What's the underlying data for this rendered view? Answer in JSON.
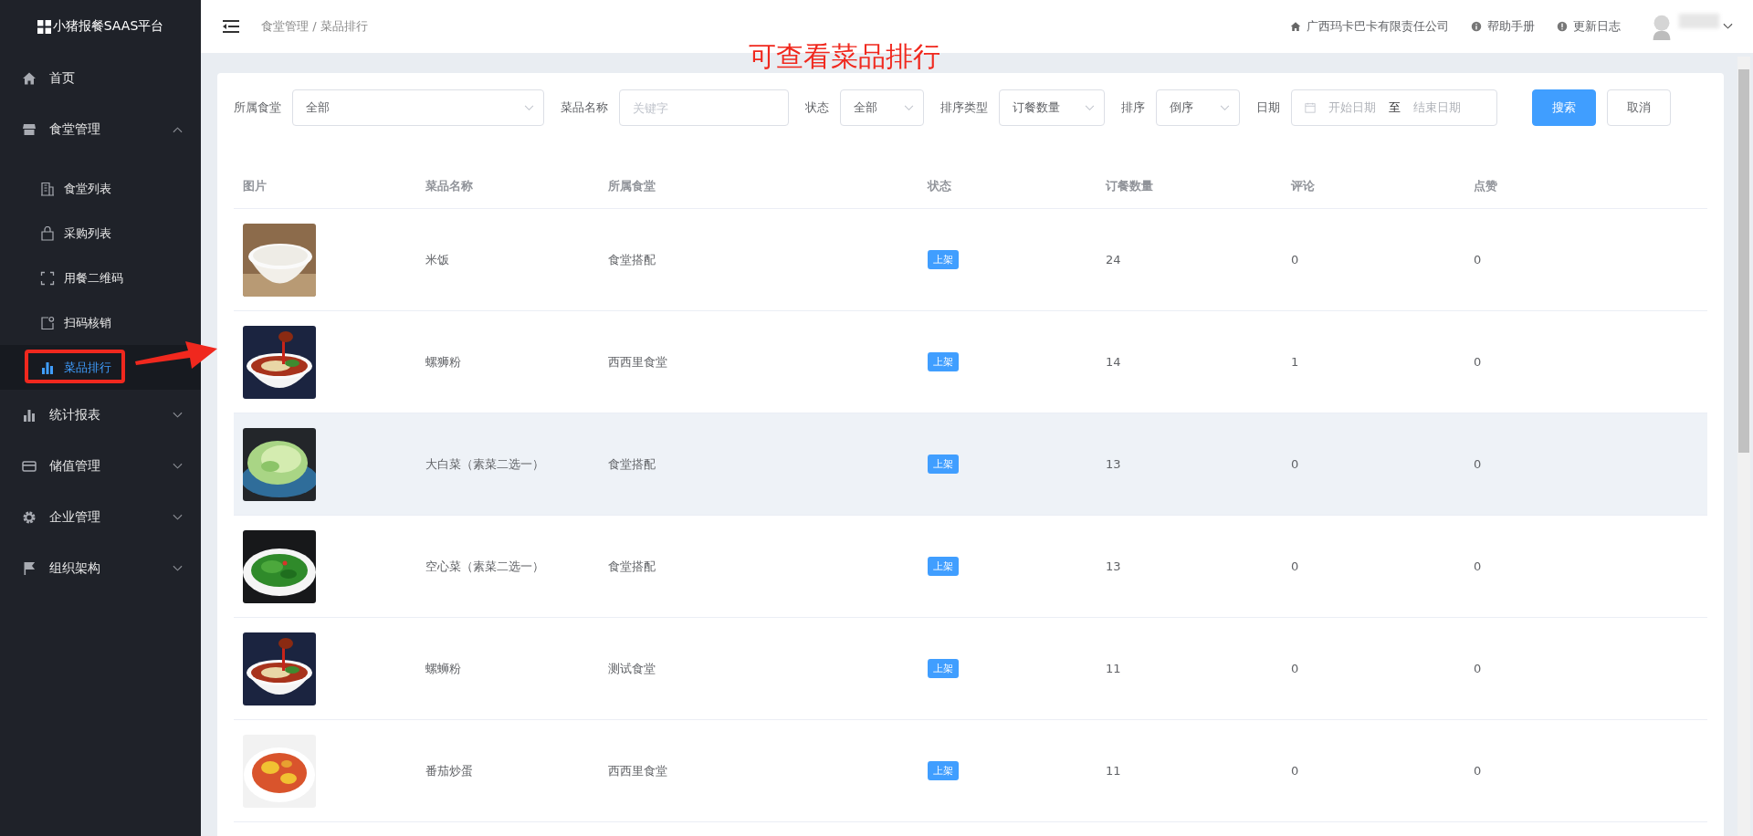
{
  "sidebar": {
    "logo": "小猪报餐SAAS平台",
    "items": [
      {
        "label": "首页",
        "selected": false
      },
      {
        "label": "食堂管理",
        "selected": false,
        "expanded": true,
        "children": [
          {
            "label": "食堂列表",
            "selected": false
          },
          {
            "label": "采购列表",
            "selected": false
          },
          {
            "label": "用餐二维码",
            "selected": false
          },
          {
            "label": "扫码核销",
            "selected": false
          },
          {
            "label": "菜品排行",
            "selected": true
          }
        ]
      },
      {
        "label": "统计报表",
        "selected": false,
        "expanded": false
      },
      {
        "label": "储值管理",
        "selected": false,
        "expanded": false
      },
      {
        "label": "企业管理",
        "selected": false,
        "expanded": false
      },
      {
        "label": "组织架构",
        "selected": false,
        "expanded": false
      }
    ]
  },
  "header": {
    "breadcrumb": "食堂管理 / 菜品排行",
    "links": [
      {
        "label": "广西玛卡巴卡有限责任公司"
      },
      {
        "label": "帮助手册"
      },
      {
        "label": "更新日志"
      }
    ]
  },
  "annotation": {
    "text": "可查看菜品排行",
    "highlight_box": true,
    "arrow": true
  },
  "filters": [
    {
      "label": "所属食堂",
      "kind": "select",
      "value": "全部"
    },
    {
      "label": "菜品名称",
      "kind": "input",
      "placeholder": "关键字"
    },
    {
      "label": "状态",
      "kind": "select",
      "value": "全部"
    },
    {
      "label": "排序类型",
      "kind": "select",
      "value": "订餐数量"
    },
    {
      "label": "排序",
      "kind": "select",
      "value": "倒序"
    },
    {
      "label": "日期",
      "kind": "daterange",
      "start_placeholder": "开始日期",
      "separator": "至",
      "end_placeholder": "结束日期"
    }
  ],
  "buttons": [
    {
      "label": "搜索",
      "kind": "primary"
    },
    {
      "label": "取消",
      "kind": "default"
    }
  ],
  "table": {
    "columns": [
      "图片",
      "菜品名称",
      "所属食堂",
      "状态",
      "订餐数量",
      "评论",
      "点赞"
    ],
    "rows": [
      {
        "name": "米饭",
        "canteen": "食堂搭配",
        "status": "上架",
        "orders": "24",
        "comments": "0",
        "likes": "0",
        "hovered": false
      },
      {
        "name": "螺狮粉",
        "canteen": "西西里食堂",
        "status": "上架",
        "orders": "14",
        "comments": "1",
        "likes": "0",
        "hovered": false
      },
      {
        "name": "大白菜（素菜二选一）",
        "canteen": "食堂搭配",
        "status": "上架",
        "orders": "13",
        "comments": "0",
        "likes": "0",
        "hovered": true
      },
      {
        "name": "空心菜（素菜二选一）",
        "canteen": "食堂搭配",
        "status": "上架",
        "orders": "13",
        "comments": "0",
        "likes": "0",
        "hovered": false
      },
      {
        "name": "螺蛳粉",
        "canteen": "测试食堂",
        "status": "上架",
        "orders": "11",
        "comments": "0",
        "likes": "0",
        "hovered": false
      },
      {
        "name": "番茄炒蛋",
        "canteen": "西西里食堂",
        "status": "上架",
        "orders": "11",
        "comments": "0",
        "likes": "0",
        "hovered": false
      }
    ]
  }
}
